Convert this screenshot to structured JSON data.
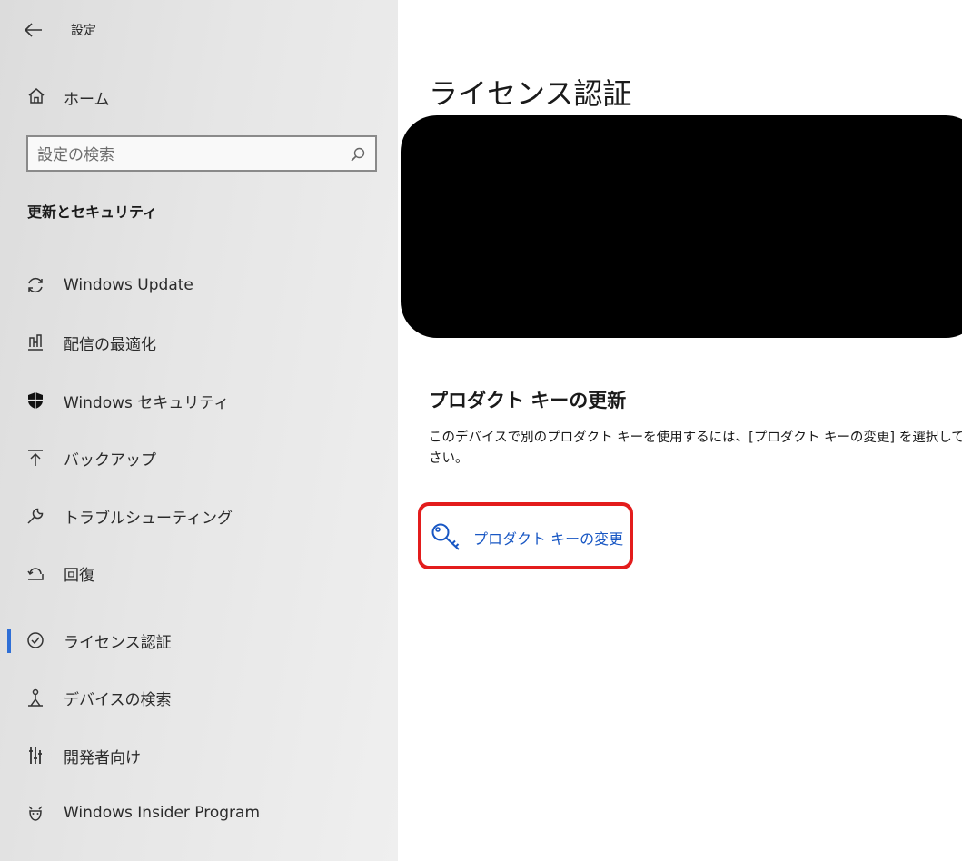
{
  "window": {
    "title": "設定"
  },
  "sidebar": {
    "home_label": "ホーム",
    "search": {
      "placeholder": "設定の検索",
      "value": ""
    },
    "section_heading": "更新とセキュリティ",
    "items": [
      {
        "label": "Windows Update",
        "icon": "sync-icon",
        "selected": false
      },
      {
        "label": "配信の最適化",
        "icon": "delivery-optimization-icon",
        "selected": false
      },
      {
        "label": "Windows セキュリティ",
        "icon": "shield-icon",
        "selected": false
      },
      {
        "label": "バックアップ",
        "icon": "backup-icon",
        "selected": false
      },
      {
        "label": "トラブルシューティング",
        "icon": "wrench-icon",
        "selected": false
      },
      {
        "label": "回復",
        "icon": "recovery-icon",
        "selected": false
      },
      {
        "label": "ライセンス認証",
        "icon": "check-circle-icon",
        "selected": true
      },
      {
        "label": "デバイスの検索",
        "icon": "find-device-icon",
        "selected": false
      },
      {
        "label": "開発者向け",
        "icon": "developer-icon",
        "selected": false
      },
      {
        "label": "Windows Insider Program",
        "icon": "insider-icon",
        "selected": false
      }
    ]
  },
  "main": {
    "title": "ライセンス認証",
    "product_key": {
      "heading": "プロダクト キーの更新",
      "description": "このデバイスで別のプロダクト キーを使用するには、[プロダクト キーの変更] を選択してください。",
      "change_link": "プロダクト キーの変更"
    }
  },
  "colors": {
    "accent": "#2f6fd6",
    "link": "#1857c4",
    "highlight_border": "#e31c1c"
  }
}
